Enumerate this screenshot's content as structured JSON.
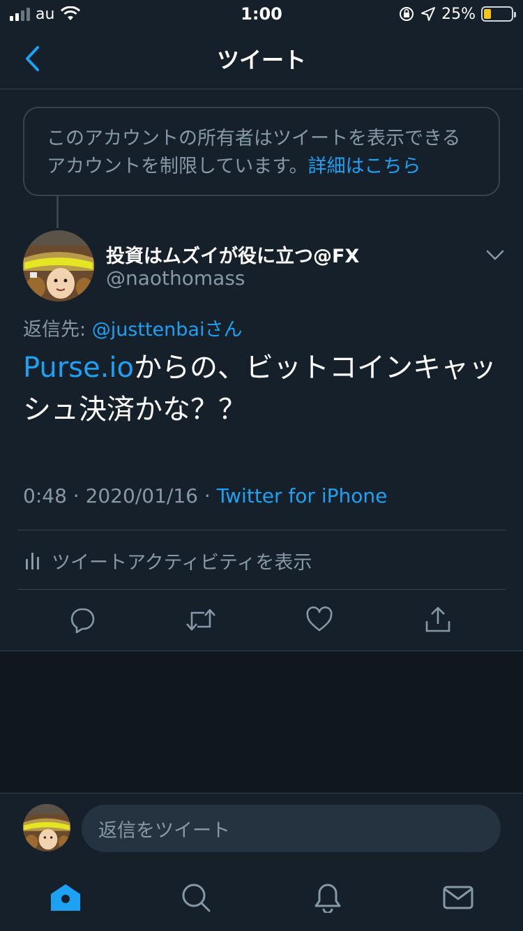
{
  "status_bar": {
    "carrier": "au",
    "time": "1:00",
    "battery_percent": "25%",
    "battery_level": 0.25,
    "signal_bars": 2,
    "signal_max": 4
  },
  "nav": {
    "title": "ツイート",
    "back_icon": "chevron-left-icon"
  },
  "notice": {
    "text": "このアカウントの所有者はツイートを表示できるアカウントを制限しています。",
    "link": "詳細はこちら"
  },
  "author": {
    "name": "投資はムズイが役に立つ@FX",
    "handle": "@naothomass",
    "avatar_icon": "avatar-image"
  },
  "reply_to": {
    "label": "返信先: ",
    "handle": "@justtenbai",
    "suffix": "さん"
  },
  "tweet": {
    "link": "Purse.io",
    "text": "からの、ビットコインキャッシュ決済かな？？"
  },
  "meta": {
    "time": "0:48",
    "sep1": " · ",
    "date": "2020/01/16",
    "sep2": " · ",
    "source": "Twitter for iPhone"
  },
  "activity": {
    "label": "ツイートアクティビティを表示",
    "icon": "bar-chart-icon"
  },
  "actions": {
    "icons": [
      "reply-icon",
      "retweet-icon",
      "like-icon",
      "share-icon"
    ]
  },
  "reply_bar": {
    "placeholder": "返信をツイート"
  },
  "tabbar": {
    "icons": [
      "home-icon",
      "search-icon",
      "notifications-icon",
      "messages-icon"
    ]
  },
  "colors": {
    "background": "#15202b",
    "accent": "#1da1f2",
    "secondary_text": "#8899a6",
    "border": "#38444d"
  }
}
